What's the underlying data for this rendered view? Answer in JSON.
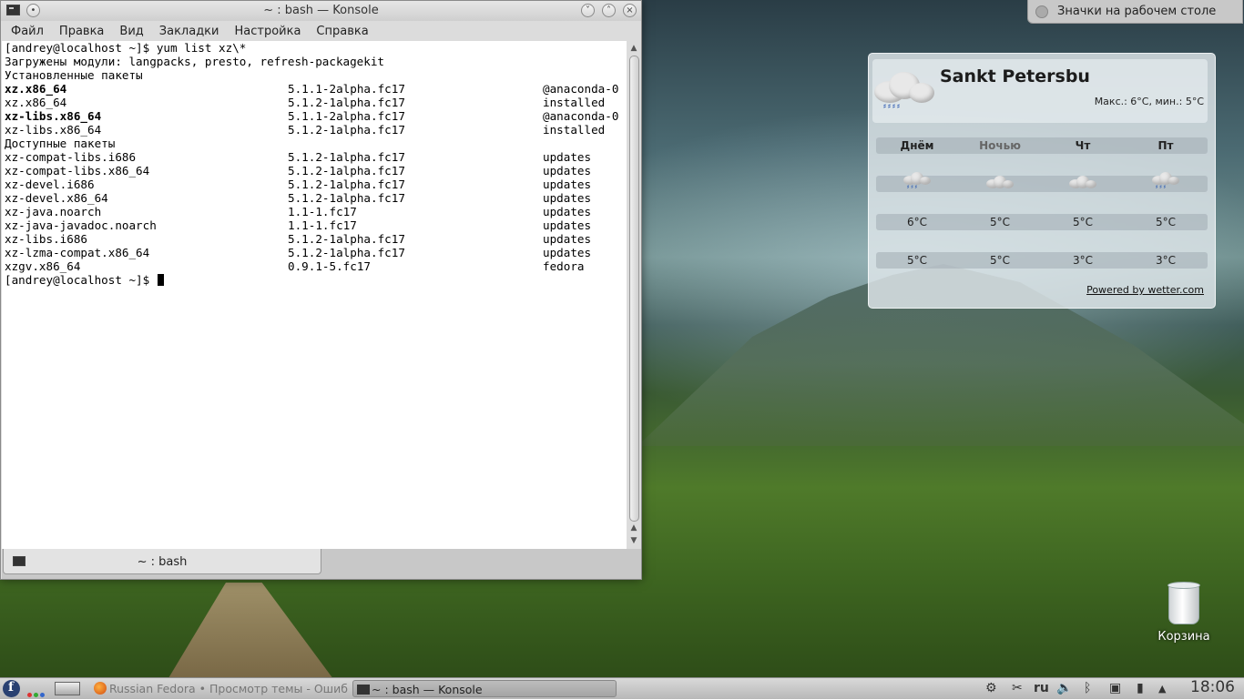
{
  "window": {
    "title": "~ : bash — Konsole",
    "menu": [
      "Файл",
      "Правка",
      "Вид",
      "Закладки",
      "Настройка",
      "Справка"
    ],
    "tab_label": "~ : bash"
  },
  "terminal": {
    "prompt": "[andrey@localhost ~]$ ",
    "command": "yum list xz\\*",
    "loaded_plugins": "Загружены модули: langpacks, presto, refresh-packagekit",
    "installed_header": "Установленные пакеты",
    "installed": [
      {
        "name": "xz.x86_64",
        "version": "5.1.1-2alpha.fc17",
        "repo": "@anaconda-0",
        "bold": true
      },
      {
        "name": "xz.x86_64",
        "version": "5.1.2-1alpha.fc17",
        "repo": "installed",
        "bold": false
      },
      {
        "name": "xz-libs.x86_64",
        "version": "5.1.1-2alpha.fc17",
        "repo": "@anaconda-0",
        "bold": true
      },
      {
        "name": "xz-libs.x86_64",
        "version": "5.1.2-1alpha.fc17",
        "repo": "installed",
        "bold": false
      }
    ],
    "available_header": "Доступные пакеты",
    "available": [
      {
        "name": "xz-compat-libs.i686",
        "version": "5.1.2-1alpha.fc17",
        "repo": "updates"
      },
      {
        "name": "xz-compat-libs.x86_64",
        "version": "5.1.2-1alpha.fc17",
        "repo": "updates"
      },
      {
        "name": "xz-devel.i686",
        "version": "5.1.2-1alpha.fc17",
        "repo": "updates"
      },
      {
        "name": "xz-devel.x86_64",
        "version": "5.1.2-1alpha.fc17",
        "repo": "updates"
      },
      {
        "name": "xz-java.noarch",
        "version": "1.1-1.fc17",
        "repo": "updates"
      },
      {
        "name": "xz-java-javadoc.noarch",
        "version": "1.1-1.fc17",
        "repo": "updates"
      },
      {
        "name": "xz-libs.i686",
        "version": "5.1.2-1alpha.fc17",
        "repo": "updates"
      },
      {
        "name": "xz-lzma-compat.x86_64",
        "version": "5.1.2-1alpha.fc17",
        "repo": "updates"
      },
      {
        "name": "xzgv.x86_64",
        "version": "0.9.1-5.fc17",
        "repo": "fedora"
      }
    ]
  },
  "desktop_folder": "Значки на рабочем столе",
  "weather": {
    "city": "Sankt Petersbu",
    "minmax": "Макс.: 6°C, мин.: 5°C",
    "columns": [
      {
        "label": "Днём",
        "high": "6°C",
        "low": "5°C",
        "icon": "rain-cloud-icon",
        "dim": false
      },
      {
        "label": "Ночью",
        "high": "5°C",
        "low": "5°C",
        "icon": "cloud-icon",
        "dim": true
      },
      {
        "label": "Чт",
        "high": "5°C",
        "low": "3°C",
        "icon": "cloud-icon",
        "dim": false
      },
      {
        "label": "Пт",
        "high": "5°C",
        "low": "3°C",
        "icon": "rain-cloud-icon",
        "dim": false
      }
    ],
    "powered_by": "Powered by wetter.com"
  },
  "trash_label": "Корзина",
  "taskbar": {
    "task1": "Russian Fedora • Просмотр темы - Ошиб",
    "task2": "~ : bash — Konsole",
    "lang": "ru",
    "clock": "18:06"
  },
  "colors": {
    "fedora_blue": "#294172",
    "terminal_bg": "#ffffff"
  }
}
